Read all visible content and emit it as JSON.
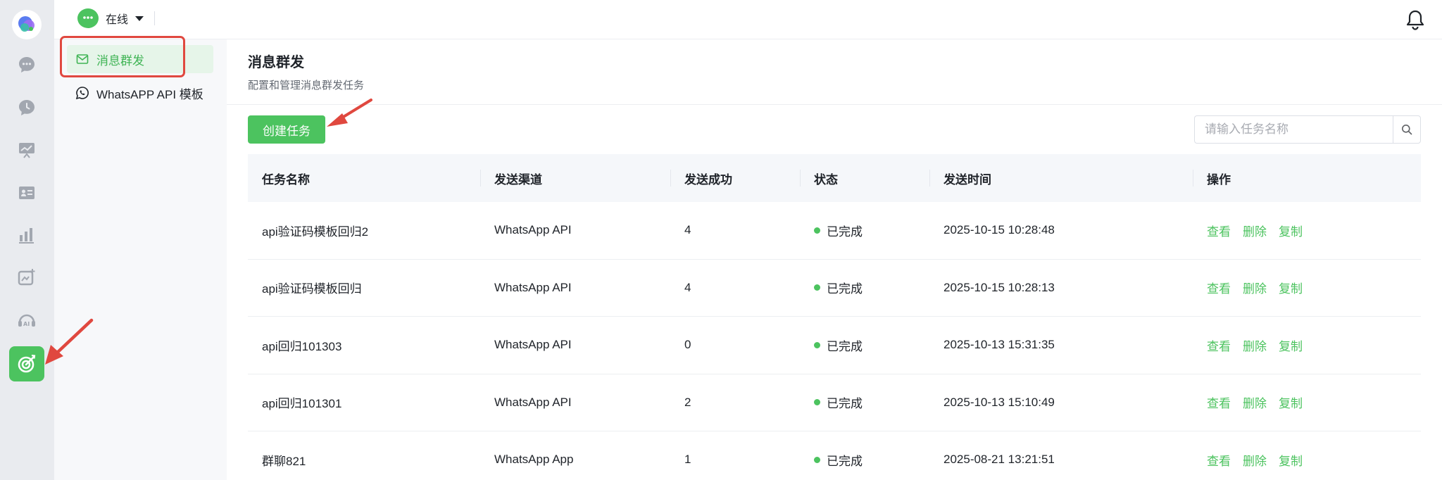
{
  "topbar": {
    "status_label": "在线"
  },
  "subnav": {
    "items": [
      {
        "label": "消息群发",
        "icon": "mail-icon",
        "active": true
      },
      {
        "label": "WhatsAPP API 模板",
        "icon": "whatsapp-icon",
        "active": false
      }
    ]
  },
  "page": {
    "title": "消息群发",
    "description": "配置和管理消息群发任务",
    "create_label": "创建任务",
    "search_placeholder": "请输入任务名称"
  },
  "table": {
    "headers": [
      "任务名称",
      "发送渠道",
      "发送成功",
      "状态",
      "发送时间",
      "操作"
    ],
    "rows": [
      {
        "name": "api验证码模板回归2",
        "channel": "WhatsApp API",
        "success": "4",
        "status": "已完成",
        "time": "2025-10-15 10:28:48"
      },
      {
        "name": "api验证码模板回归",
        "channel": "WhatsApp API",
        "success": "4",
        "status": "已完成",
        "time": "2025-10-15 10:28:13"
      },
      {
        "name": "api回归101303",
        "channel": "WhatsApp API",
        "success": "0",
        "status": "已完成",
        "time": "2025-10-13 15:31:35"
      },
      {
        "name": "api回归101301",
        "channel": "WhatsApp API",
        "success": "2",
        "status": "已完成",
        "time": "2025-10-13 15:10:49"
      },
      {
        "name": "群聊821",
        "channel": "WhatsApp App",
        "success": "1",
        "status": "已完成",
        "time": "2025-08-21 13:21:51"
      }
    ],
    "actions": {
      "view": "查看",
      "delete": "删除",
      "copy": "复制"
    }
  },
  "colors": {
    "accent": "#4cc35f",
    "annotation": "#e0483f",
    "rail_bg": "#e9ebef"
  }
}
